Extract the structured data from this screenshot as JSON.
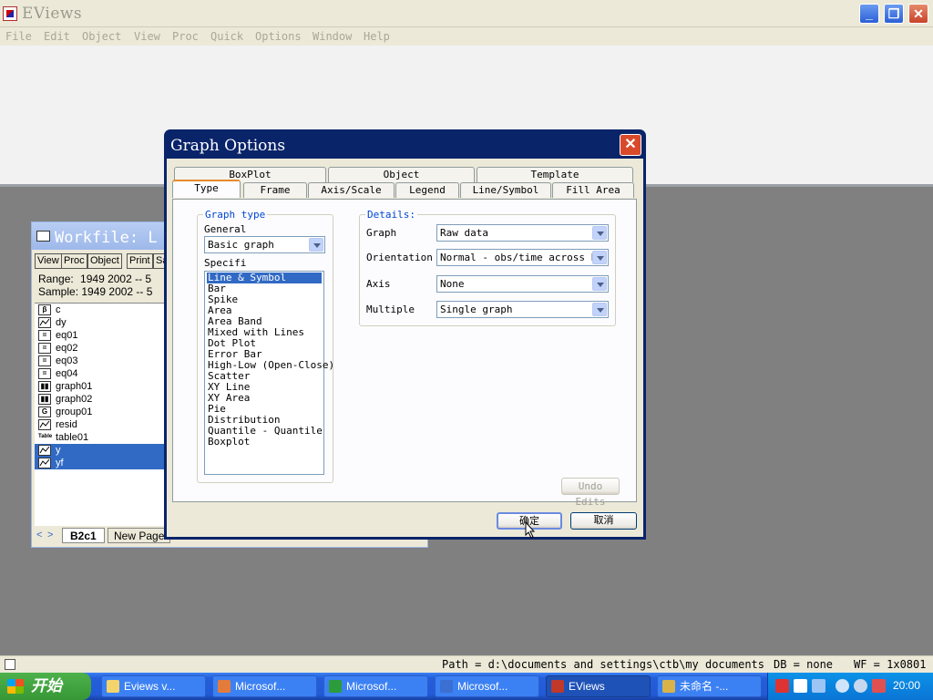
{
  "app": {
    "title": "EViews"
  },
  "menu": [
    "File",
    "Edit",
    "Object",
    "View",
    "Proc",
    "Quick",
    "Options",
    "Window",
    "Help"
  ],
  "workfile": {
    "title": "Workfile: L",
    "toolbar": [
      "View",
      "Proc",
      "Object",
      "Print",
      "Sa"
    ],
    "range_label": "Range:",
    "range_value": "1949 2002  --  5",
    "sample_label": "Sample:",
    "sample_value": "1949 2002  --  5",
    "items": [
      {
        "name": "c",
        "icon": "coef-icon",
        "glyph": "β",
        "selected": false
      },
      {
        "name": "dy",
        "icon": "series-icon",
        "glyph": "",
        "selected": false
      },
      {
        "name": "eq01",
        "icon": "equation-icon",
        "glyph": "=",
        "selected": false
      },
      {
        "name": "eq02",
        "icon": "equation-icon",
        "glyph": "=",
        "selected": false
      },
      {
        "name": "eq03",
        "icon": "equation-icon",
        "glyph": "=",
        "selected": false
      },
      {
        "name": "eq04",
        "icon": "equation-icon",
        "glyph": "=",
        "selected": false
      },
      {
        "name": "graph01",
        "icon": "graph-icon",
        "glyph": "▮▮",
        "selected": false
      },
      {
        "name": "graph02",
        "icon": "graph-icon",
        "glyph": "▮▮",
        "selected": false
      },
      {
        "name": "group01",
        "icon": "group-icon",
        "glyph": "G",
        "selected": false
      },
      {
        "name": "resid",
        "icon": "series-icon",
        "glyph": "",
        "selected": false
      },
      {
        "name": "table01",
        "icon": "table-icon",
        "glyph": "Table",
        "selected": false
      },
      {
        "name": "y",
        "icon": "series-icon",
        "glyph": "",
        "selected": true
      },
      {
        "name": "yf",
        "icon": "series-icon",
        "glyph": "",
        "selected": true
      }
    ],
    "tabs": [
      "B2c1",
      "New Page"
    ]
  },
  "dialog": {
    "title": "Graph Options",
    "tabs_back": [
      "BoxPlot",
      "Object",
      "Template"
    ],
    "tabs_front": [
      "Type",
      "Frame",
      "Axis/Scale",
      "Legend",
      "Line/Symbol",
      "Fill Area"
    ],
    "active_tab": "Type",
    "graph_type_legend": "Graph type",
    "general_label": "General",
    "general_value": "Basic graph",
    "specific_label": "Specifi",
    "specific_options": [
      "Line & Symbol",
      "Bar",
      "Spike",
      "Area",
      "Area Band",
      "Mixed with Lines",
      "Dot Plot",
      "Error Bar",
      "High-Low (Open-Close)",
      "Scatter",
      "XY Line",
      "XY Area",
      "Pie",
      "Distribution",
      "Quantile - Quantile",
      "Boxplot"
    ],
    "specific_selected": "Line & Symbol",
    "details_legend": "Details:",
    "details": [
      {
        "label": "Graph",
        "value": "Raw data"
      },
      {
        "label": "Orientation",
        "value": "Normal - obs/time across bo"
      },
      {
        "label": "Axis",
        "value": "None"
      },
      {
        "label": "Multiple",
        "value": "Single graph"
      }
    ],
    "undo_label": "Undo Edits",
    "ok_label": "确定",
    "cancel_label": "取消"
  },
  "statusbar": {
    "path": "Path = d:\\documents and settings\\ctb\\my documents",
    "db": "DB = none",
    "wf": "WF = 1x0801"
  },
  "taskbar": {
    "start_label": "开始",
    "tasks": [
      {
        "label": "Eviews v...",
        "icon": "folder-icon",
        "color": "#f3d36b",
        "active": false
      },
      {
        "label": "Microsof...",
        "icon": "outlook-icon",
        "color": "#e37b3b",
        "active": false
      },
      {
        "label": "Microsof...",
        "icon": "excel-icon",
        "color": "#2c9b3c",
        "active": false
      },
      {
        "label": "Microsof...",
        "icon": "word-icon",
        "color": "#3b6fd1",
        "active": false
      },
      {
        "label": "EViews",
        "icon": "eviews-icon",
        "color": "#c0392b",
        "active": true
      },
      {
        "label": "未命名 -...",
        "icon": "paint-icon",
        "color": "#d9b34a",
        "active": false
      }
    ],
    "clock": "20:00"
  }
}
